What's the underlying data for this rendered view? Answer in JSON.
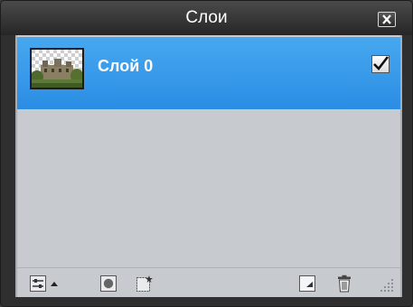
{
  "window": {
    "title": "Слои"
  },
  "layers": [
    {
      "name": "Слой 0",
      "visible": true,
      "selected": true
    }
  ],
  "toolbar": {
    "icons": [
      "layer-options-icon",
      "expand-arrow-icon",
      "layer-mask-icon",
      "adjustment-layer-icon",
      "new-layer-icon",
      "delete-layer-icon",
      "resize-grip-icon"
    ]
  },
  "colors": {
    "selection": "#2f94e8",
    "panel_bg": "#c7cbcf",
    "titlebar": "#333333"
  }
}
